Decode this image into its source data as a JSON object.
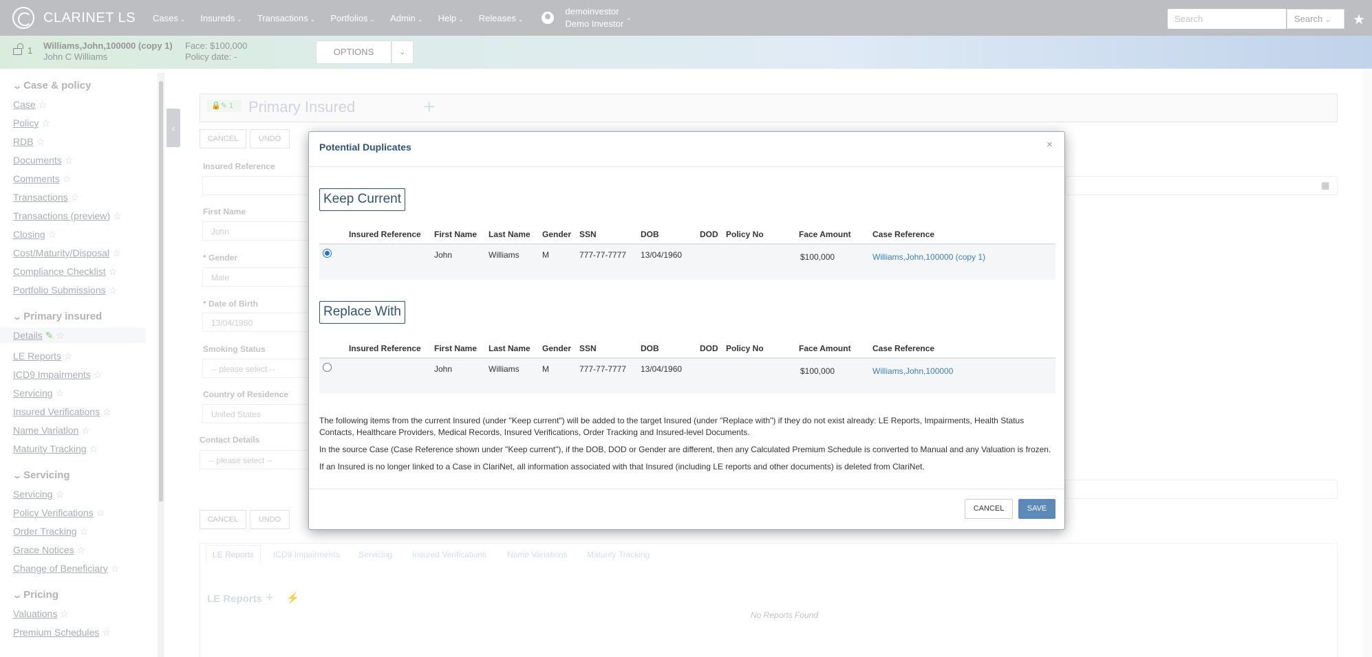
{
  "app": {
    "title": "CLARINET LS"
  },
  "nav": {
    "items": [
      "Cases",
      "Insureds",
      "Transactions",
      "Portfolios",
      "Admin",
      "Help",
      "Releases"
    ],
    "user_name": "demoinvestor",
    "user_role": "Demo Investor",
    "search_placeholder": "Search",
    "search_button": "Search"
  },
  "case": {
    "lock_count": "1",
    "name": "Williams,John,100000 (copy 1)",
    "insured": "John C Williams",
    "face": "Face: $100,000",
    "policy_date": "Policy date: -",
    "options_label": "OPTIONS"
  },
  "sidebar": {
    "sections": [
      {
        "title": "Case & policy",
        "items": [
          "Case",
          "Policy",
          "RDB",
          "Documents",
          "Comments",
          "Transactions",
          "Transactions (preview)",
          "Closing",
          "Cost/Maturity/Disposal",
          "Compliance Checklist",
          "Portfolio Submissions"
        ]
      },
      {
        "title": "Primary insured",
        "items": [
          "Details",
          "LE Reports",
          "ICD9 Impairments",
          "Servicing",
          "Insured Verifications",
          "Name Variation",
          "Maturity Tracking"
        ]
      },
      {
        "title": "Servicing",
        "items": [
          "Servicing",
          "Policy Verifications",
          "Order Tracking",
          "Grace Notices",
          "Change of Beneficiary"
        ]
      },
      {
        "title": "Pricing",
        "items": [
          "Valuations",
          "Premium Schedules"
        ]
      }
    ]
  },
  "main": {
    "lock_badge": "1",
    "title": "Primary Insured",
    "cancel": "CANCEL",
    "undo": "UNDO",
    "fields": {
      "insured_reference_label": "Insured Reference",
      "first_name_label": "First Name",
      "first_name_value": "John",
      "gender_label": "* Gender",
      "gender_value": "Male",
      "dob_label": "* Date of Birth",
      "dob_value": "13/04/1960",
      "smoking_label": "Smoking Status",
      "smoking_value": "-- please select --",
      "country_label": "Country of Residence",
      "country_value": "United States",
      "contact_label": "Contact Details",
      "contact_value": "-- please select --"
    },
    "tabs": [
      "LE Reports",
      "ICD9 Impairments",
      "Servicing",
      "Insured Verifications",
      "Name Variations",
      "Maturity Tracking"
    ],
    "le_title": "LE Reports",
    "no_reports": "No Reports Found"
  },
  "modal": {
    "title": "Potential Duplicates",
    "close": "×",
    "columns": [
      "Insured Reference",
      "First Name",
      "Last Name",
      "Gender",
      "SSN",
      "DOB",
      "DOD",
      "Policy No",
      "Face Amount",
      "Case Reference"
    ],
    "keep": {
      "heading": "Keep Current",
      "row": {
        "insured_reference": "",
        "first_name": "John",
        "last_name": "Williams",
        "gender": "M",
        "ssn": "777-77-7777",
        "dob": "13/04/1960",
        "dod": "",
        "policy_no": "",
        "face_amount": "$100,000",
        "case_reference": "Williams,John,100000 (copy 1)"
      },
      "selected": true
    },
    "replace": {
      "heading": "Replace With",
      "row": {
        "insured_reference": "",
        "first_name": "John",
        "last_name": "Williams",
        "gender": "M",
        "ssn": "777-77-7777",
        "dob": "13/04/1960",
        "dod": "",
        "policy_no": "",
        "face_amount": "$100,000",
        "case_reference": "Williams,John,100000"
      },
      "selected": false
    },
    "notes": [
      "The following items from the current Insured (under \"Keep current\") will be added to the target Insured (under \"Replace with\") if they do not exist already: LE Reports, Impairments, Health Status Contacts, Healthcare Providers, Medical Records, Insured Verifications, Order Tracking and Insured-level Documents.",
      "In the source Case (Case Reference shown under \"Keep current\"), if the DOB, DOD or Gender are different, then any Calculated Premium Schedule is converted to Manual and any Valuation is frozen.",
      "If an Insured is no longer linked to a Case in ClariNet, all information associated with that Insured (including LE reports and other documents) is deleted from ClariNet."
    ],
    "cancel": "CANCEL",
    "save": "SAVE"
  }
}
